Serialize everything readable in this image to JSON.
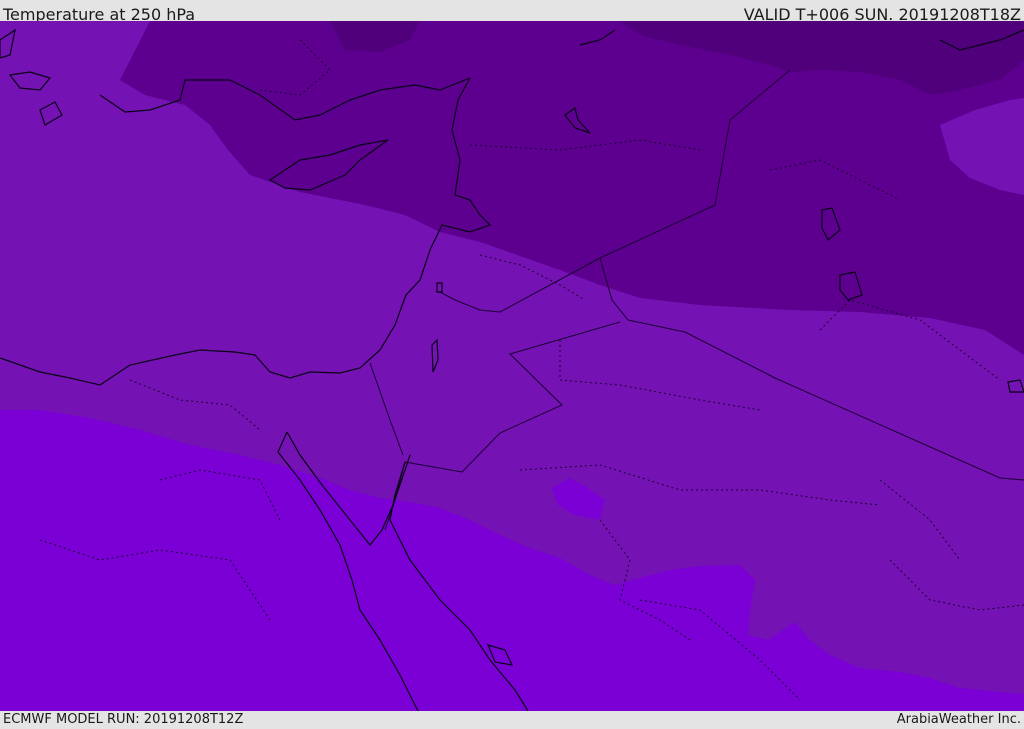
{
  "header": {
    "title": "Temperature at 250 hPa",
    "valid": "VALID T+006 SUN. 20191208T18Z"
  },
  "footer": {
    "model_run": "ECMWF MODEL RUN: 20191208T12Z",
    "provider": "ArabiaWeather Inc."
  },
  "map": {
    "field": "temperature",
    "level": "250 hPa",
    "legend": "none",
    "colors": {
      "band_coldest": "#4f007a",
      "band_cold": "#5d0090",
      "band_mid": "#7412b3",
      "band_warm": "#7a00d6",
      "coastline": "#0a0018",
      "border": "#1a0033"
    }
  }
}
